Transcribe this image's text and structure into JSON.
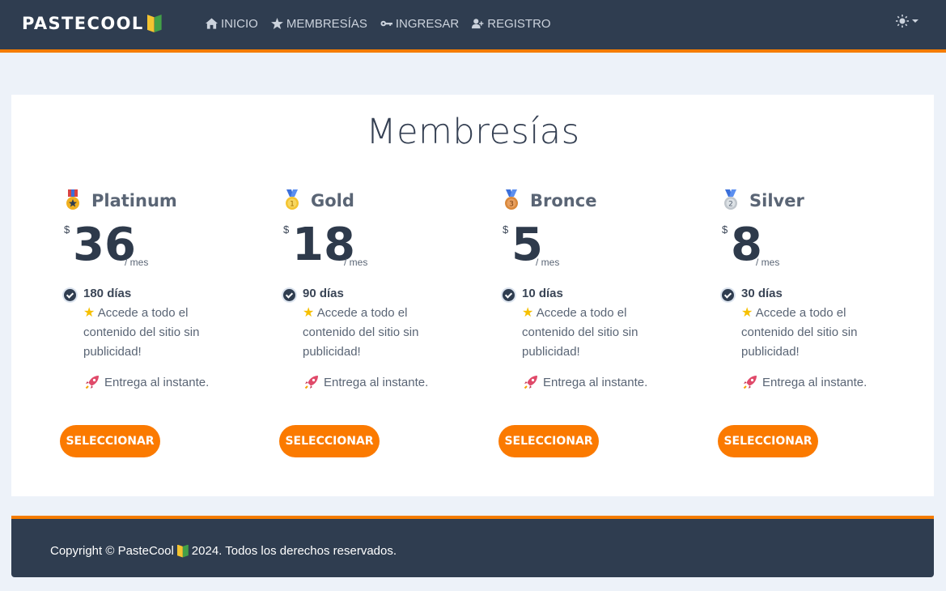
{
  "navbar": {
    "brand": "PASTECOOL",
    "items": [
      {
        "label": "INICIO",
        "icon": "home-icon"
      },
      {
        "label": "MEMBRESÍAS",
        "icon": "star-icon"
      },
      {
        "label": "INGRESAR",
        "icon": "key-icon"
      },
      {
        "label": "REGISTRO",
        "icon": "user-plus-icon"
      }
    ],
    "theme_icon": "sun-icon"
  },
  "main": {
    "title": "Membresías",
    "plans": [
      {
        "name": "Platinum",
        "currency": "$",
        "amount": "36",
        "period": "/ mes",
        "days": "180 días",
        "benefit": "Accede a todo el contenido del sitio sin publicidad!",
        "delivery": "Entrega al instante.",
        "button": "SELECCIONAR",
        "medal_color": "#f0b020"
      },
      {
        "name": "Gold",
        "currency": "$",
        "amount": "18",
        "period": "/ mes",
        "days": "90 días",
        "benefit": "Accede a todo el contenido del sitio sin publicidad!",
        "delivery": "Entrega al instante.",
        "button": "SELECCIONAR",
        "medal_color": "#f4c430"
      },
      {
        "name": "Bronce",
        "currency": "$",
        "amount": "5",
        "period": "/ mes",
        "days": "10 días",
        "benefit": "Accede a todo el contenido del sitio sin publicidad!",
        "delivery": "Entrega al instante.",
        "button": "SELECCIONAR",
        "medal_color": "#d9883a"
      },
      {
        "name": "Silver",
        "currency": "$",
        "amount": "8",
        "period": "/ mes",
        "days": "30 días",
        "benefit": "Accede a todo el contenido del sitio sin publicidad!",
        "delivery": "Entrega al instante.",
        "button": "SELECCIONAR",
        "medal_color": "#c0c6cc"
      }
    ]
  },
  "footer": {
    "text_before": "Copyright © PasteCool",
    "text_after": "2024. Todos los derechos reservados."
  },
  "colors": {
    "navbar_bg": "#2f3d50",
    "accent": "#f57c00",
    "button": "#fb7a00",
    "page_bg": "#edf2f9"
  }
}
